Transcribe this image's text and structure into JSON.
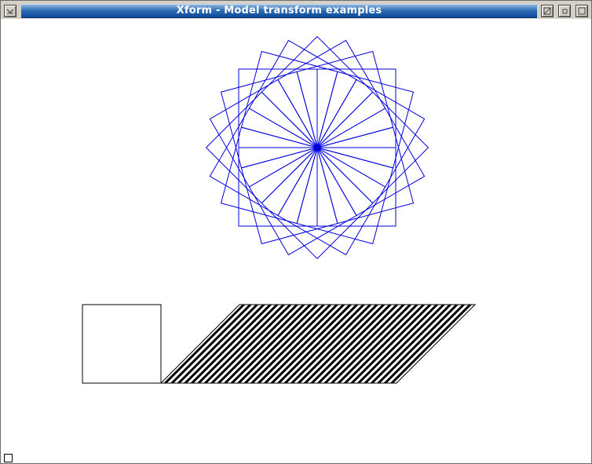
{
  "window": {
    "title": "Xform - Model transform examples"
  },
  "titlebar_buttons": {
    "menu_icon": "menu-icon",
    "shade_icon": "shade-icon",
    "iconify_icon": "minimize-icon",
    "close_icon": "close-icon"
  },
  "colors": {
    "titlebar_start": "#8fb5de",
    "titlebar_end": "#0c4a99",
    "rotated_squares_stroke": "#0000e0",
    "shape_stroke": "#000000",
    "background": "#ffffff"
  },
  "drawing": {
    "rotated_squares_count": 24,
    "rotation_step_degrees": 3.75
  }
}
